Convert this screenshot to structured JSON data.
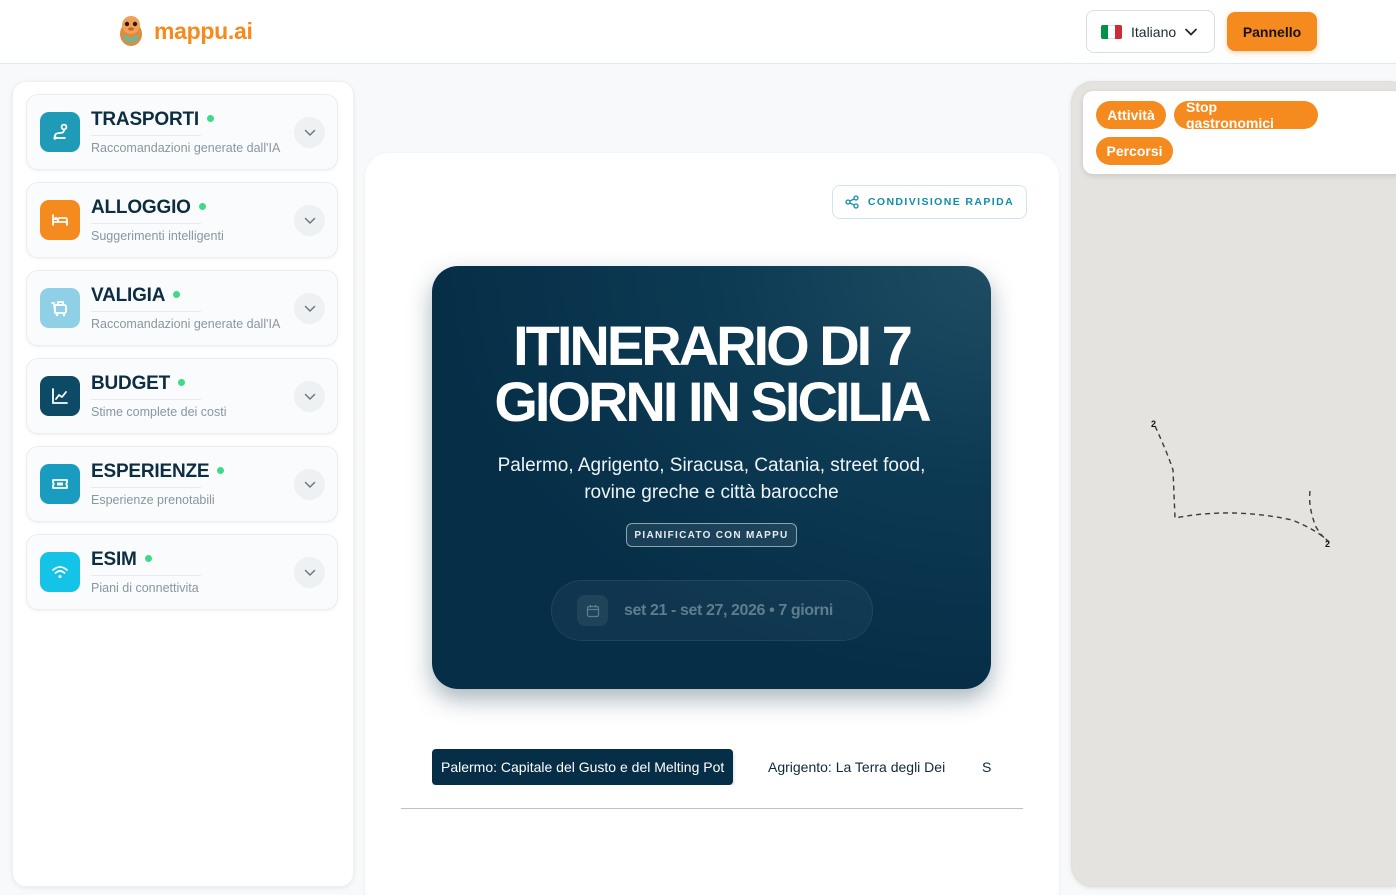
{
  "brand": {
    "name": "mappu.ai"
  },
  "header": {
    "language": {
      "label": "Italiano",
      "flag_colors": [
        "#009246",
        "#ffffff",
        "#ce2b37"
      ]
    },
    "panel_button": "Pannello"
  },
  "sidebar": {
    "items": [
      {
        "title": "TRASPORTI",
        "subtitle": "Raccomandazioni generate dall'IA",
        "icon": "route-icon",
        "color": "#1f9bb8"
      },
      {
        "title": "ALLOGGIO",
        "subtitle": "Suggerimenti intelligenti",
        "icon": "bed-icon",
        "color": "#f58a1f"
      },
      {
        "title": "VALIGIA",
        "subtitle": "Raccomandazioni generate dall'IA",
        "icon": "luggage-icon",
        "color": "#8fd0e6"
      },
      {
        "title": "BUDGET",
        "subtitle": "Stime complete dei costi",
        "icon": "chart-icon",
        "color": "#0d4a66"
      },
      {
        "title": "ESPERIENZE",
        "subtitle": "Esperienze prenotabili",
        "icon": "ticket-icon",
        "color": "#1a9cc0"
      },
      {
        "title": "ESIM",
        "subtitle": "Piani di connettivita",
        "icon": "wifi-icon",
        "color": "#15c3e6"
      }
    ],
    "status_color": "#3ddc84"
  },
  "main": {
    "share_button": "CONDIVISIONE RAPIDA",
    "hero": {
      "title_line1": "ITINERARIO DI 7",
      "title_line2": "GIORNI IN SICILIA",
      "subtitle_line1": "Palermo, Agrigento, Siracusa, Catania, street food,",
      "subtitle_line2": "rovine greche e città barocche",
      "badge": "PIANIFICATO CON MAPPU",
      "dates": "set 21 - set 27, 2026 • 7 giorni"
    },
    "tabs": [
      {
        "label": "Palermo: Capitale del Gusto e del Melting Pot",
        "active": true
      },
      {
        "label": "Agrigento: La Terra degli Dei",
        "active": false
      },
      {
        "label": "S",
        "active": false
      }
    ]
  },
  "map": {
    "filters": [
      "Attività",
      "Stop gastronomici",
      "Percorsi"
    ],
    "markers": [
      "2",
      "2"
    ],
    "accent": "#f58a1f"
  }
}
